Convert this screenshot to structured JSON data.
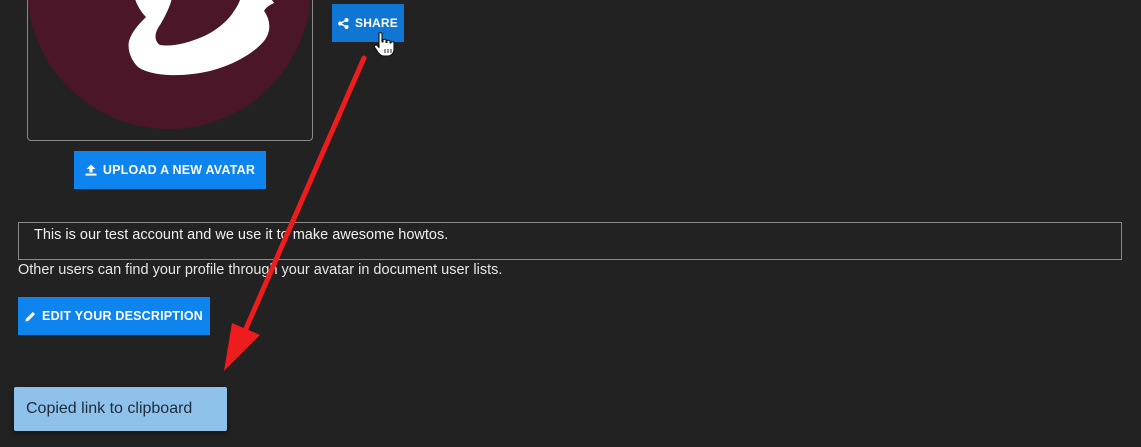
{
  "profile": {
    "avatar_alt": "Profile avatar",
    "share_label": "SHARE",
    "upload_label": "UPLOAD A NEW AVATAR",
    "description": "This is our test account and we use it to make awesome howtos.",
    "description_hint": "Other users can find your profile through your avatar in document user lists.",
    "edit_label": "EDIT YOUR DESCRIPTION"
  },
  "toast": {
    "message": "Copied link to clipboard"
  },
  "icons": {
    "share": "share-icon",
    "upload": "upload-icon",
    "edit": "pencil-icon",
    "cursor": "hand-pointer-icon"
  },
  "colors": {
    "background": "#222222",
    "button": "#0d84ee",
    "avatar_circle": "#4a1628",
    "toast": "#8fc2eb",
    "annotation_arrow": "#ee1c1c"
  }
}
